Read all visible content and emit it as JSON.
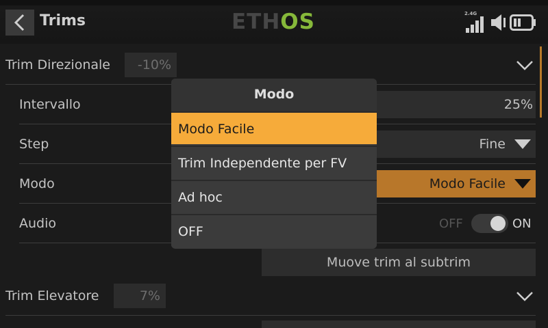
{
  "header": {
    "title": "Trims",
    "logo_left": "ETH",
    "logo_right": "OS",
    "signal_label": "2.4G"
  },
  "rows": {
    "trim_direzionale": {
      "label": "Trim Direzionale",
      "value": "-10%"
    },
    "intervallo": {
      "label": "Intervallo",
      "value": "25%"
    },
    "step": {
      "label": "Step",
      "value": "Fine"
    },
    "modo": {
      "label": "Modo",
      "value": "Modo Facile"
    },
    "audio": {
      "label": "Audio",
      "off": "OFF",
      "on": "ON"
    },
    "subtrim_button": "Muove trim al subtrim",
    "trim_elevatore": {
      "label": "Trim Elevatore",
      "value": "7%"
    }
  },
  "popup": {
    "title": "Modo",
    "options": [
      "Modo Facile",
      "Trim Independente per FV",
      "Ad hoc",
      "OFF"
    ],
    "selected_index": 0
  },
  "colors": {
    "accent": "#f6ab3a",
    "selected_field": "#b8772a",
    "logo_green": "#86b83a"
  },
  "icons": [
    "back-arrow-icon",
    "signal-strength-icon",
    "speaker-icon",
    "battery-icon",
    "chevron-down-icon",
    "dropdown-triangle-icon",
    "toggle-icon"
  ]
}
